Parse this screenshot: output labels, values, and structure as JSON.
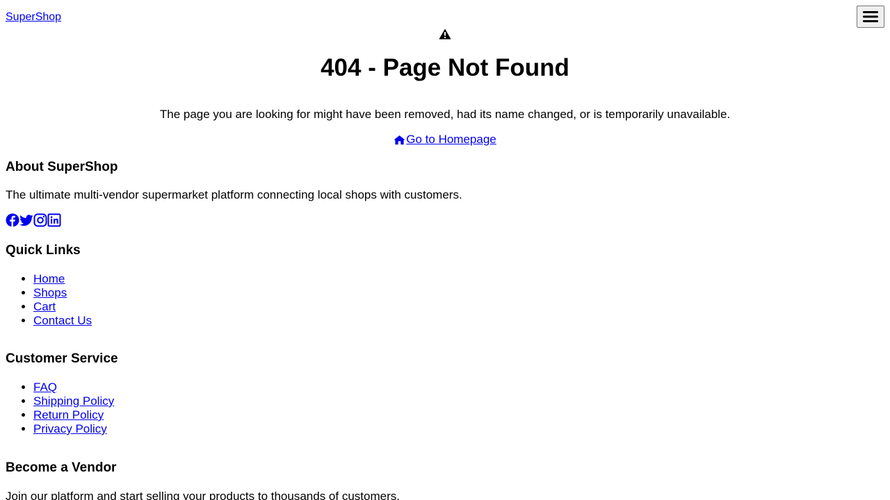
{
  "header": {
    "brand": "SuperShop",
    "menu_icon": "hamburger-menu-icon"
  },
  "error": {
    "icon": "warning-triangle-icon",
    "title": "404 - Page Not Found",
    "message": "The page you are looking for might have been removed, had its name changed, or is temporarily unavailable.",
    "home_link_icon": "home-icon",
    "home_link_label": "Go to Homepage"
  },
  "footer": {
    "about": {
      "title": "About SuperShop",
      "text": "The ultimate multi-vendor supermarket platform connecting local shops with customers.",
      "social_icons": [
        "facebook-icon",
        "twitter-icon",
        "instagram-icon",
        "linkedin-icon"
      ]
    },
    "quick_links": {
      "title": "Quick Links",
      "items": [
        "Home",
        "Shops",
        "Cart",
        "Contact Us"
      ]
    },
    "customer_service": {
      "title": "Customer Service",
      "items": [
        "FAQ",
        "Shipping Policy",
        "Return Policy",
        "Privacy Policy"
      ]
    },
    "vendor": {
      "title": "Become a Vendor",
      "text": "Join our platform and start selling your products to thousands of customers."
    }
  },
  "colors": {
    "link": "#0000ee",
    "text": "#000000",
    "background": "#ffffff"
  }
}
